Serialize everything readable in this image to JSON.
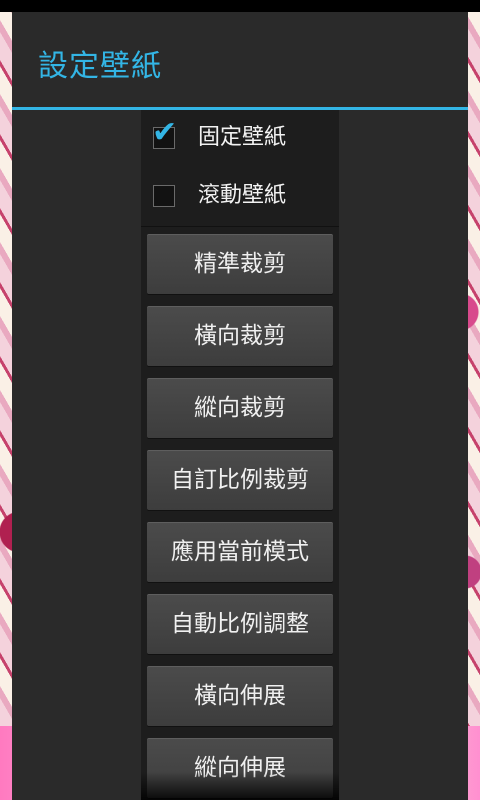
{
  "dialog": {
    "title": "設定壁紙"
  },
  "options": [
    {
      "label": "固定壁紙",
      "checked": true
    },
    {
      "label": "滾動壁紙",
      "checked": false
    }
  ],
  "buttons": [
    "精準裁剪",
    "橫向裁剪",
    "縱向裁剪",
    "自訂比例裁剪",
    "應用當前模式",
    "自動比例調整",
    "橫向伸展",
    "縱向伸展"
  ],
  "colors": {
    "accent": "#33b5e5",
    "dialog_bg": "#2a2a2a",
    "panel_bg": "#1d1d1d",
    "button_bg": "#444444"
  },
  "icons": {
    "checkmark": "check-icon"
  }
}
